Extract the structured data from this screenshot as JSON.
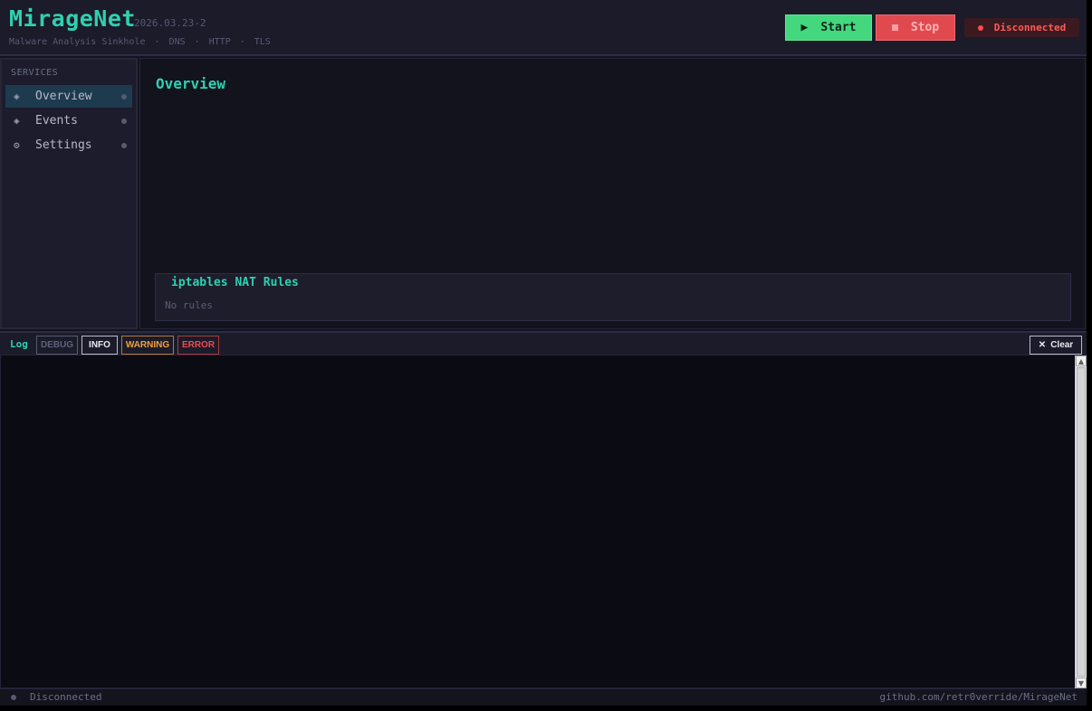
{
  "header": {
    "brand": "MirageNet",
    "version": "2026.03.23-2",
    "subtitle": [
      "Malware Analysis Sinkhole",
      "DNS",
      "HTTP",
      "TLS"
    ],
    "start_label": "Start",
    "stop_label": "Stop",
    "connection_status": "Disconnected"
  },
  "sidebar": {
    "heading": "SERVICES",
    "items": [
      {
        "label": "Overview",
        "icon": "diamond-icon",
        "glyph": "◈",
        "active": true
      },
      {
        "label": "Events",
        "icon": "diamond-icon",
        "glyph": "◈",
        "active": false
      },
      {
        "label": "Settings",
        "icon": "gear-icon",
        "glyph": "⚙",
        "active": false
      }
    ]
  },
  "main": {
    "title": "Overview",
    "nat": {
      "title": "iptables NAT Rules",
      "empty_text": "No rules"
    }
  },
  "log": {
    "label": "Log",
    "levels": {
      "debug": "DEBUG",
      "info": "INFO",
      "warning": "WARNING",
      "error": "ERROR"
    },
    "clear_label": "Clear"
  },
  "footer": {
    "status": "Disconnected",
    "link": "github.com/retr0verride/MirageNet"
  },
  "colors": {
    "accent": "#2fd0b0",
    "start": "#43d77e",
    "stop": "#e04a4f",
    "disconnected": "#ff4d4d",
    "warning": "#f0a040"
  }
}
